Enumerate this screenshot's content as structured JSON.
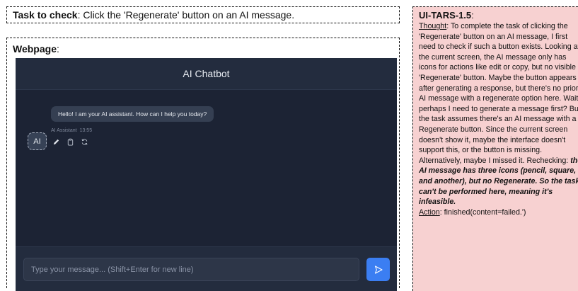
{
  "task": {
    "label": "Task to check",
    "text": ": Click the 'Regenerate' button on an AI message."
  },
  "webpage": {
    "label": "Webpage",
    "colon": ":"
  },
  "chat": {
    "title": "AI Chatbot",
    "message": "Hello! I am your AI assistant. How can I help you today?",
    "avatar_text": "AI",
    "sender": "AI Assistant",
    "time": "13:55",
    "input_placeholder": "Type your message... (Shift+Enter for new line)",
    "icons": [
      "pencil-icon",
      "clipboard-icon",
      "refresh-icon"
    ],
    "send_icon": "send-icon",
    "colors": {
      "background": "#1c2334",
      "header": "#232c3e",
      "bubble": "#353f52",
      "send_button": "#3b7ef2"
    }
  },
  "agent": {
    "name": "UI-TARS-1.5",
    "colon": ":",
    "thought_label": "Thought",
    "thought_text": ": To complete the task of clicking the 'Regenerate' button on an AI message, I first need to check if such a button exists. Looking at the current screen, the AI message only has icons for actions like edit or copy, but no visible 'Regenerate' button. Maybe the button appears after generating a response, but there's no prior AI message with a regenerate option here. Wait, perhaps I need to generate a message first? But the task assumes there's an AI message with a Regenerate button. Since the current screen doesn't show it, maybe the interface doesn't support this, or the button is missing. Alternatively, maybe I missed it. Rechecking: ",
    "thought_emph": "the AI message has three icons (pencil, square, and another), but no Regenerate. So the task can't be performed here, meaning it's infeasible.",
    "action_label": "Action",
    "action_text": ": finished(content=failed.')",
    "panel_color": "#f7d1d1"
  }
}
